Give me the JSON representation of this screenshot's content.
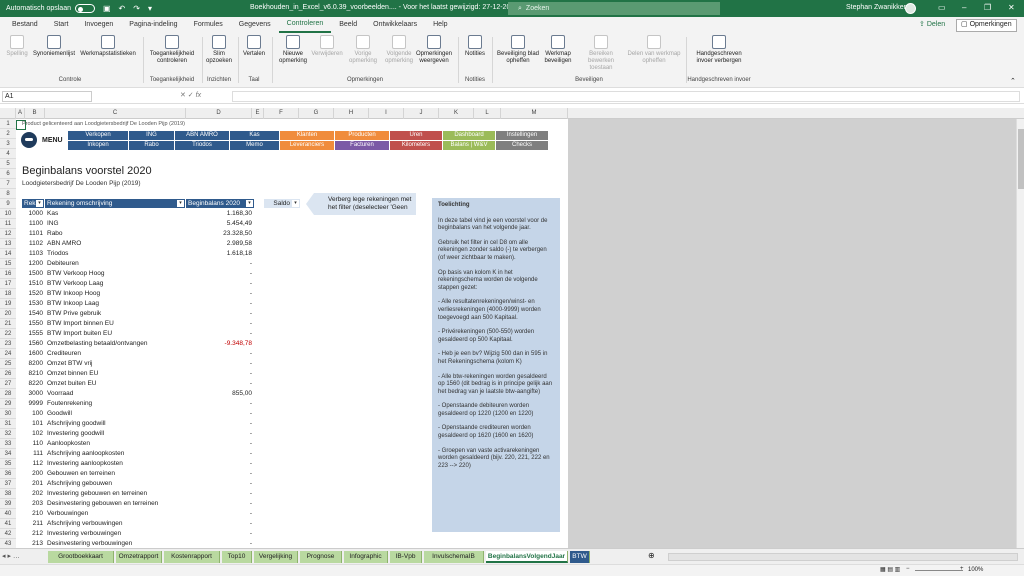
{
  "titlebar": {
    "autosave_label": "Automatisch opslaan",
    "autosave_state": "Uit",
    "document_title": "Boekhouden_in_Excel_v6.0.39_voorbeelden....  -  Voor het laatst gewijzigd: 27-12-2019",
    "search_placeholder": "Zoeken",
    "user_name": "Stephan Zwanikken"
  },
  "ribbon_tabs": [
    "Bestand",
    "Start",
    "Invoegen",
    "Pagina-indeling",
    "Formules",
    "Gegevens",
    "Controleren",
    "Beeld",
    "Ontwikkelaars",
    "Help"
  ],
  "active_tab": "Controleren",
  "share_label": "Delen",
  "comments_label": "Opmerkingen",
  "ribbon": {
    "buttons": [
      {
        "label": "Spelling",
        "disabled": true
      },
      {
        "label": "Synoniemenlijst",
        "disabled": false
      },
      {
        "label": "Werkmapstatistieken",
        "disabled": false
      },
      {
        "label": "Toegankelijkheid controleren",
        "disabled": false
      },
      {
        "label": "Slim opzoeken",
        "disabled": false
      },
      {
        "label": "Vertalen",
        "disabled": false
      },
      {
        "label": "Nieuwe opmerking",
        "disabled": false
      },
      {
        "label": "Verwijderen",
        "disabled": true
      },
      {
        "label": "Vorige opmerking",
        "disabled": true
      },
      {
        "label": "Volgende opmerking",
        "disabled": true
      },
      {
        "label": "Opmerkingen weergeven",
        "disabled": false
      },
      {
        "label": "Notities",
        "disabled": false
      },
      {
        "label": "Beveiliging blad opheffen",
        "disabled": false
      },
      {
        "label": "Werkmap beveiligen",
        "disabled": false
      },
      {
        "label": "Bereiken bewerken toestaan",
        "disabled": true
      },
      {
        "label": "Delen van werkmap opheffen",
        "disabled": true
      },
      {
        "label": "Handgeschreven invoer verbergen",
        "disabled": false
      }
    ],
    "groups": [
      "Controle",
      "Toegankelijkheid",
      "Inzichten",
      "Taal",
      "Opmerkingen",
      "Notities",
      "Beveiligen",
      "Handgeschreven invoer"
    ]
  },
  "namebox": "A1",
  "columns": [
    "A",
    "B",
    "C",
    "D",
    "E",
    "F",
    "G",
    "H",
    "I",
    "J",
    "K",
    "L",
    "M"
  ],
  "product_line": "Product gelicenteerd aan Loodgietersbedrijf De Looden Pijp (2019)",
  "menu_label": "MENU",
  "menu": {
    "row1": [
      "Verkopen",
      "ING",
      "ABN AMRO",
      "Kas",
      "Klanten",
      "Producten",
      "Uren",
      "Dashboard",
      "Instellingen"
    ],
    "row2": [
      "Inkopen",
      "Rabo",
      "Triodos",
      "Memo",
      "Leveranciers",
      "Facturen",
      "Kilometers",
      "Balans | W&V",
      "Checks"
    ],
    "colors": {
      "blue": "#2f5a8c",
      "orange": "#f08c3c",
      "purple": "#7b5aa6",
      "red": "#c0504d",
      "green": "#9bbb59",
      "gray": "#7f7f7f"
    }
  },
  "sheet_title": "Beginbalans voorstel 2020",
  "sheet_subtitle": "Loodgietersbedrijf De Looden Pijp (2019)",
  "table_headers": {
    "code": "Rek",
    "desc": "Rekening omschrijving",
    "amount": "Beginbalans 2020",
    "saldo": "Saldo"
  },
  "rows": [
    {
      "code": "1000",
      "desc": "Kas",
      "amount": "1.168,30"
    },
    {
      "code": "1100",
      "desc": "ING",
      "amount": "5.454,49"
    },
    {
      "code": "1101",
      "desc": "Rabo",
      "amount": "23.328,50"
    },
    {
      "code": "1102",
      "desc": "ABN AMRO",
      "amount": "2.989,58"
    },
    {
      "code": "1103",
      "desc": "Triodos",
      "amount": "1.618,18"
    },
    {
      "code": "1200",
      "desc": "Debiteuren",
      "amount": "-"
    },
    {
      "code": "1500",
      "desc": "BTW Verkoop Hoog",
      "amount": "-"
    },
    {
      "code": "1510",
      "desc": "BTW Verkoop Laag",
      "amount": "-"
    },
    {
      "code": "1520",
      "desc": "BTW Inkoop Hoog",
      "amount": "-"
    },
    {
      "code": "1530",
      "desc": "BTW Inkoop Laag",
      "amount": "-"
    },
    {
      "code": "1540",
      "desc": "BTW Prive gebruik",
      "amount": "-"
    },
    {
      "code": "1550",
      "desc": "BTW Import binnen EU",
      "amount": "-"
    },
    {
      "code": "1555",
      "desc": "BTW Import buiten EU",
      "amount": "-"
    },
    {
      "code": "1560",
      "desc": "Omzetbelasting betaald/ontvangen",
      "amount": "-9.348,78"
    },
    {
      "code": "1600",
      "desc": "Crediteuren",
      "amount": "-"
    },
    {
      "code": "8200",
      "desc": "Omzet BTW vrij",
      "amount": "-"
    },
    {
      "code": "8210",
      "desc": "Omzet binnen EU",
      "amount": "-"
    },
    {
      "code": "8220",
      "desc": "Omzet buiten EU",
      "amount": "-"
    },
    {
      "code": "3000",
      "desc": "Voorraad",
      "amount": "855,00"
    },
    {
      "code": "9999",
      "desc": "Foutenrekening",
      "amount": "-"
    },
    {
      "code": "100",
      "desc": "Goodwill",
      "amount": "-"
    },
    {
      "code": "101",
      "desc": "Afschrijving goodwill",
      "amount": "-"
    },
    {
      "code": "102",
      "desc": "Investering goodwill",
      "amount": "-"
    },
    {
      "code": "110",
      "desc": "Aanloopkosten",
      "amount": "-"
    },
    {
      "code": "111",
      "desc": "Afschrijving aanloopkosten",
      "amount": "-"
    },
    {
      "code": "112",
      "desc": "Investering aanloopkosten",
      "amount": "-"
    },
    {
      "code": "200",
      "desc": "Gebouwen en terreinen",
      "amount": "-"
    },
    {
      "code": "201",
      "desc": "Afschrijving gebouwen",
      "amount": "-"
    },
    {
      "code": "202",
      "desc": "Investering gebouwen en terreinen",
      "amount": "-"
    },
    {
      "code": "203",
      "desc": "Desinvestering gebouwen en terreinen",
      "amount": "-"
    },
    {
      "code": "210",
      "desc": "Verbouwingen",
      "amount": "-"
    },
    {
      "code": "211",
      "desc": "Afschrijving verbouwingen",
      "amount": "-"
    },
    {
      "code": "212",
      "desc": "Investering verbouwingen",
      "amount": "-"
    },
    {
      "code": "213",
      "desc": "Desinvestering verbouwingen",
      "amount": "-"
    }
  ],
  "callout_text": "Verberg lege rekeningen met het filter (deselecteer 'Geen",
  "note": {
    "title": "Toelichting",
    "paragraphs": [
      "In deze tabel vind je een voorstel voor de beginbalans van het volgende jaar.",
      "Gebruik het filter in cel D8 om alle rekeningen zonder saldo (-) te verbergen (of weer zichtbaar te maken).",
      "Op basis van kolom K in het rekeningschema worden de volgende stappen gezet:",
      "- Alle resultatenrekeningen/winst- en verliesrekeningen (4000-9999) worden toegevoegd aan 500 Kapitaal.",
      "- Privérekeningen (500-550) worden gesaldeerd op 500 Kapitaal.",
      "- Heb je een bv? Wijzig 500 dan in 595 in het Rekeningschema (kolom K)",
      "- Alle btw-rekeningen worden gesaldeerd op 1560 (dit bedrag is in principe gelijk aan het bedrag van je laatste btw-aangifte)",
      "- Openstaande debiteuren worden gesaldeerd op 1220 (1200 en 1220)",
      "- Openstaande crediteuren worden gesaldeerd op 1620 (1600 en 1620)",
      "- Groepen van vaste activarekeningen worden gesaldeerd (bijv. 220, 221, 222 en 223 --> 220)"
    ]
  },
  "sheet_tabs": [
    "Grootboekkaart",
    "Omzetrapport",
    "Kostenrapport",
    "Top10",
    "Vergelijking",
    "Prognose",
    "Infographic",
    "IB-Vpb",
    "InvulschemaIB",
    "BeginbalansVolgendJaar",
    "BTW"
  ],
  "active_sheet": "BeginbalansVolgendJaar",
  "zoom": "100%"
}
